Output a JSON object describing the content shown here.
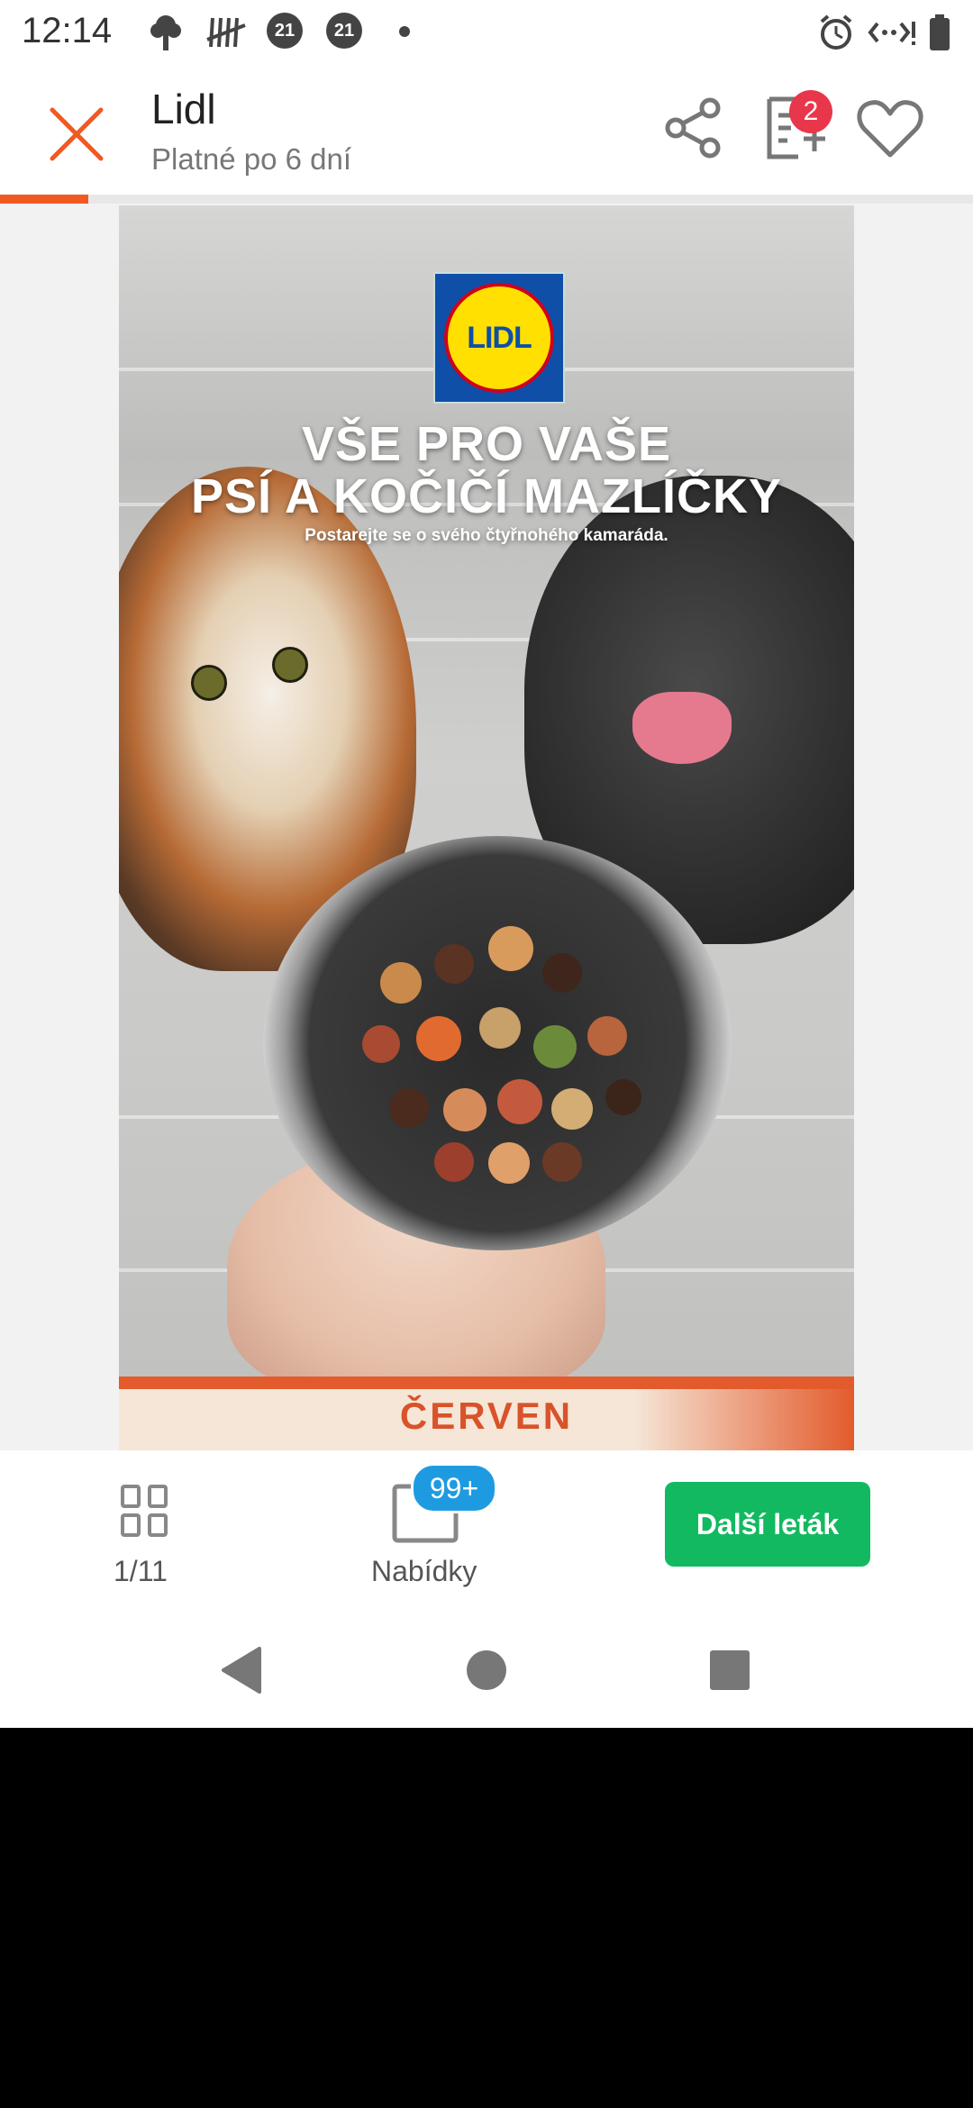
{
  "status_bar": {
    "time": "12:14",
    "notification_badges": [
      "21",
      "21"
    ],
    "icons": [
      "tree-notification-icon",
      "tally-notification-icon",
      "alarm-icon",
      "data-saver-icon",
      "battery-icon"
    ]
  },
  "header": {
    "title": "Lidl",
    "subtitle": "Platné po 6 dní",
    "cart_count": "2",
    "icons": [
      "close-icon",
      "share-icon",
      "shopping-list-add-icon",
      "favorite-heart-icon"
    ]
  },
  "progress": {
    "current_page": 1,
    "total_pages": 11,
    "fraction": 0.0909
  },
  "flyer": {
    "brand_logo": "LIDL",
    "headline_line1": "VŠE PRO VAŠE",
    "headline_line2": "PSÍ A KOČIČÍ MAZLÍČKY",
    "tagline": "Postarejte se o svého čtyřnohého kamaráda.",
    "month": "ČERVEN"
  },
  "bottom_bar": {
    "pages_label": "1/11",
    "offers_label": "Nabídky",
    "offers_badge": "99+",
    "next_button": "Další leták"
  },
  "colors": {
    "accent_orange": "#f05a22",
    "badge_red": "#e8374a",
    "badge_blue": "#1e9be0",
    "button_green": "#13b960"
  }
}
